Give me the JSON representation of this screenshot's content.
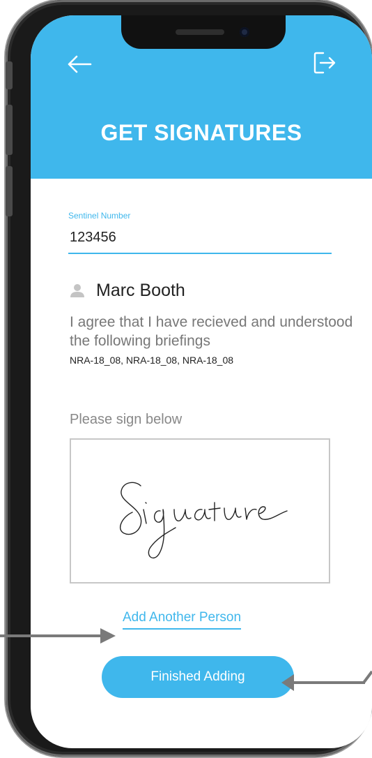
{
  "header": {
    "title": "GET SIGNATURES",
    "back_icon": "arrow-left-icon",
    "logout_icon": "logout-icon"
  },
  "form": {
    "sentinel_label": "Sentinel Number",
    "sentinel_value": "123456"
  },
  "person": {
    "icon": "user-icon",
    "name": "Marc Booth"
  },
  "agreement": {
    "text": "I agree that I have recieved and understood the following briefings",
    "briefings": "NRA-18_08, NRA-18_08, NRA-18_08"
  },
  "signature": {
    "prompt": "Please sign below"
  },
  "actions": {
    "add_person_label": "Add Another Person",
    "finished_label": "Finished Adding"
  },
  "colors": {
    "accent": "#3fb7ec",
    "header_text": "#ffffff",
    "muted_text": "#777777",
    "pad_border": "#c7c7c7"
  }
}
